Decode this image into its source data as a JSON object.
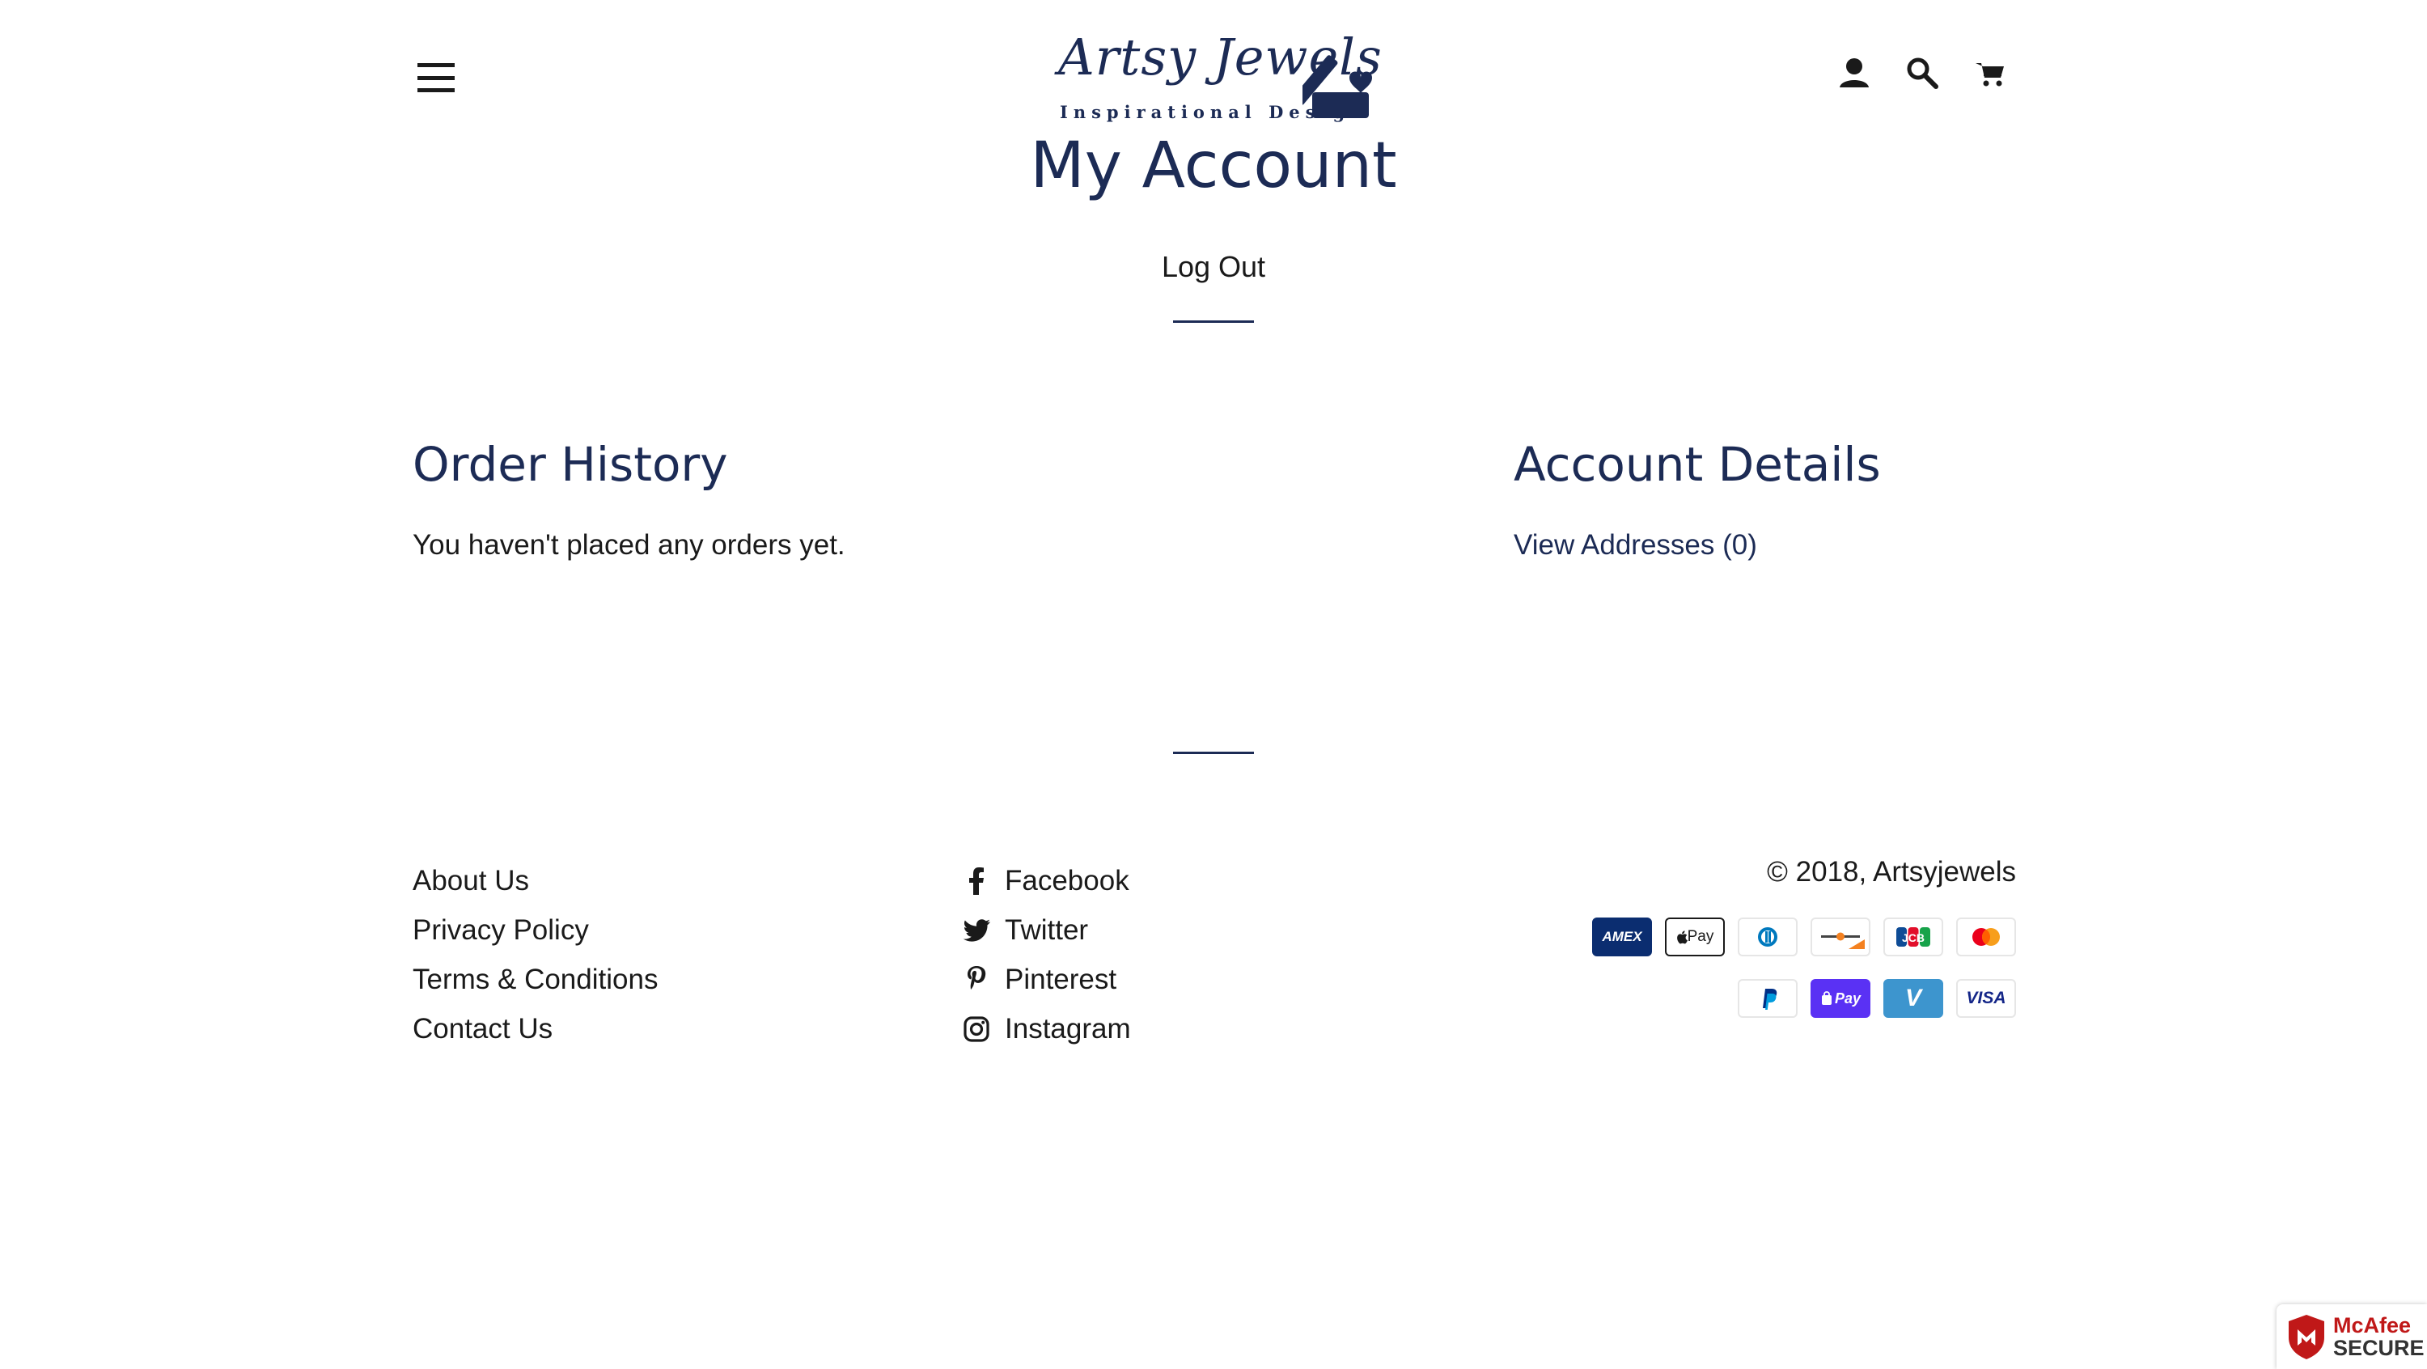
{
  "header": {
    "menu_icon": "hamburger-menu-icon",
    "logo": {
      "script_text": "Artsy Jewels",
      "tagline": "Inspirational Design",
      "color": "#1c2b55"
    },
    "icons": [
      "account-icon",
      "search-icon",
      "cart-icon"
    ]
  },
  "page": {
    "title": "My Account",
    "logout_label": "Log Out"
  },
  "order_history": {
    "title": "Order History",
    "empty_text": "You haven't placed any orders yet."
  },
  "account_details": {
    "title": "Account Details",
    "addresses_link": "View Addresses (0)"
  },
  "footer": {
    "links": [
      "About Us",
      "Privacy Policy",
      "Terms & Conditions",
      "Contact Us"
    ],
    "social": [
      {
        "label": "Facebook",
        "icon": "facebook-icon"
      },
      {
        "label": "Twitter",
        "icon": "twitter-icon"
      },
      {
        "label": "Pinterest",
        "icon": "pinterest-icon"
      },
      {
        "label": "Instagram",
        "icon": "instagram-icon"
      }
    ],
    "copyright": "© 2018, Artsyjewels",
    "payments_row1": [
      "AMEX",
      "Pay",
      "diners",
      "discover",
      "JCB",
      "mastercard"
    ],
    "payments_row2": [
      "PayPal",
      "Pay",
      "V",
      "VISA"
    ]
  },
  "badge": {
    "brand": "McAfee",
    "label": "SECURE"
  },
  "colors": {
    "brand": "#1c2b55",
    "text": "#1a1a1a",
    "mcafee_red": "#c01818"
  }
}
